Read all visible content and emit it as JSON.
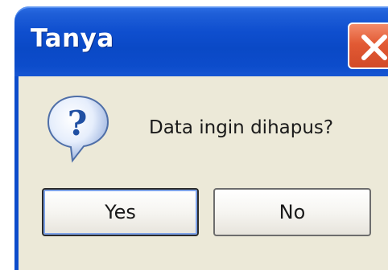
{
  "dialog": {
    "title": "Tanya",
    "message": "Data ingin dihapus?",
    "icon": "question-icon",
    "buttons": {
      "yes_label": "Yes",
      "no_label": "No"
    }
  },
  "colors": {
    "titlebar": "#0a49c6",
    "body": "#ece9d8",
    "close_button": "#e25a34"
  }
}
